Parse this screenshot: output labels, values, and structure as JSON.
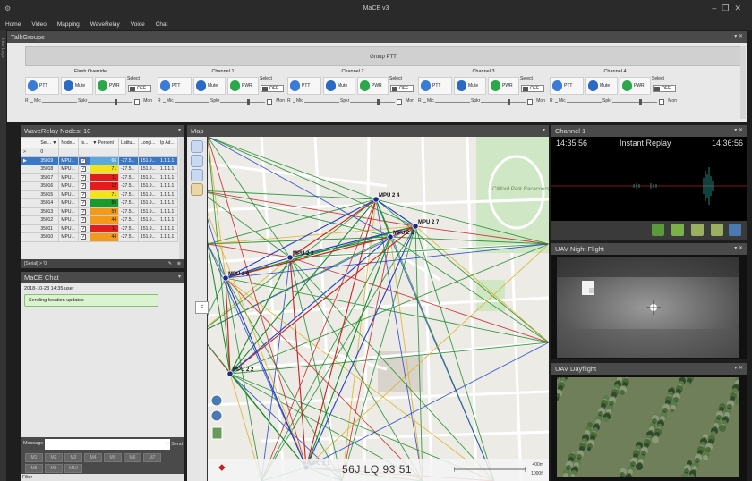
{
  "window": {
    "title": "MaCE v3",
    "controls": [
      "–",
      "❐",
      "✕"
    ]
  },
  "menu": [
    "Home",
    "Video",
    "Mapping",
    "WaveRelay",
    "Voice",
    "Chat"
  ],
  "left_strip_label": "Intel Logs",
  "talkgroups": {
    "title": "TalkGroups",
    "group_ptt": "Group PTT",
    "channels": [
      {
        "name": "Flash Override",
        "ptt": "PTT",
        "mute": "Mute",
        "pwr": "PWR",
        "select": "Select",
        "off": "OFF",
        "r": "R",
        "mic": "Mic",
        "spkr": "Spkr",
        "mon": "Mon"
      },
      {
        "name": "Channel 1",
        "ptt": "PTT",
        "mute": "Mute",
        "pwr": "PWR",
        "select": "Select",
        "off": "OFF",
        "r": "R",
        "mic": "Mic",
        "spkr": "Spkr",
        "mon": "Mon"
      },
      {
        "name": "Channel 2",
        "ptt": "PTT",
        "mute": "Mute",
        "pwr": "PWR",
        "select": "Select",
        "off": "OFF",
        "r": "R",
        "mic": "Mic",
        "spkr": "Spkr",
        "mon": "Mon"
      },
      {
        "name": "Channel 3",
        "ptt": "PTT",
        "mute": "Mute",
        "pwr": "PWR",
        "select": "Select",
        "off": "OFF",
        "r": "R",
        "mic": "Mic",
        "spkr": "Spkr",
        "mon": "Mon"
      },
      {
        "name": "Channel 4",
        "ptt": "PTT",
        "mute": "Mute",
        "pwr": "PWR",
        "select": "Select",
        "off": "OFF",
        "r": "R",
        "mic": "Mic",
        "spkr": "Spkr",
        "mon": "Mon"
      }
    ]
  },
  "waverelay": {
    "title": "WaveRelay Nodes: 10",
    "columns": [
      "Ser... ▼",
      "Node...",
      "Is...",
      "▼ Percent",
      "Latitu...",
      "Longi...",
      "Ip Ad..."
    ],
    "filter_row": [
      "0",
      "",
      "",
      "",
      "",
      "",
      ""
    ],
    "rows": [
      {
        "serial": "35019",
        "node": "MPU...",
        "pct": "66",
        "lat": "-27.5...",
        "lon": "151.9...",
        "ip": "1.1.1.1",
        "color": "#5aa8e0",
        "selected": true
      },
      {
        "serial": "35018",
        "node": "MPU...",
        "pct": "71",
        "lat": "-27.5...",
        "lon": "151.9...",
        "ip": "1.1.1.1",
        "color": "#f5e31a",
        "selected": false
      },
      {
        "serial": "35017",
        "node": "MPU...",
        "pct": "11",
        "lat": "-27.5...",
        "lon": "151.9...",
        "ip": "1.1.1.1",
        "color": "#e51c1c",
        "selected": false
      },
      {
        "serial": "35016",
        "node": "MPU...",
        "pct": "12",
        "lat": "-27.5...",
        "lon": "151.9...",
        "ip": "1.1.1.1",
        "color": "#e51c1c",
        "selected": false
      },
      {
        "serial": "35015",
        "node": "MPU...",
        "pct": "71",
        "lat": "-27.5...",
        "lon": "151.9...",
        "ip": "1.1.1.1",
        "color": "#f5e31a",
        "selected": false
      },
      {
        "serial": "35014",
        "node": "MPU...",
        "pct": "85",
        "lat": "-27.5...",
        "lon": "151.9...",
        "ip": "1.1.1.1",
        "color": "#1a9a2a",
        "selected": false
      },
      {
        "serial": "35013",
        "node": "MPU...",
        "pct": "59",
        "lat": "-27.5...",
        "lon": "151.9...",
        "ip": "1.1.1.1",
        "color": "#f39a1a",
        "selected": false
      },
      {
        "serial": "35012",
        "node": "MPU...",
        "pct": "44",
        "lat": "-27.5...",
        "lon": "151.9...",
        "ip": "1.1.1.1",
        "color": "#f39a1a",
        "selected": false
      },
      {
        "serial": "35011",
        "node": "MPU...",
        "pct": "11",
        "lat": "-27.5...",
        "lon": "151.9...",
        "ip": "1.1.1.1",
        "color": "#e51c1c",
        "selected": false
      },
      {
        "serial": "35010",
        "node": "MPU...",
        "pct": "44",
        "lat": "-27.5...",
        "lon": "151.9...",
        "ip": "1.1.1.1",
        "color": "#f39a1a",
        "selected": false
      }
    ],
    "footer": "[Serial] > '0'"
  },
  "chat": {
    "title": "MaCE Chat",
    "meta": "2018-10-23 14:35 user",
    "bubble": "Sending location updates",
    "message_label": "Message",
    "send": "Send",
    "macros": [
      "M1",
      "M2",
      "M3",
      "M4",
      "M5",
      "M6",
      "M7",
      "M8",
      "M9",
      "M10"
    ],
    "filter": "Filter"
  },
  "map": {
    "title": "Map",
    "grid_ref": "56J LQ 93 51",
    "scale_top": "400m",
    "scale_bottom": "1000ft",
    "collapse": "<",
    "place_label": "Clifford Park Racecourse",
    "nodes": [
      "MPU 2 4",
      "MPU 2 7",
      "MPU 2 5",
      "MPU 2 3",
      "MPU 2 6",
      "MPU 2 2",
      "MPU 2 1"
    ]
  },
  "channel1": {
    "title": "Channel 1",
    "time_start": "14:35:56",
    "mode": "Instant Replay",
    "time_end": "14:36:56"
  },
  "uav_night": {
    "title": "UAV Night Flight"
  },
  "uav_day": {
    "title": "UAV Dayflight"
  }
}
